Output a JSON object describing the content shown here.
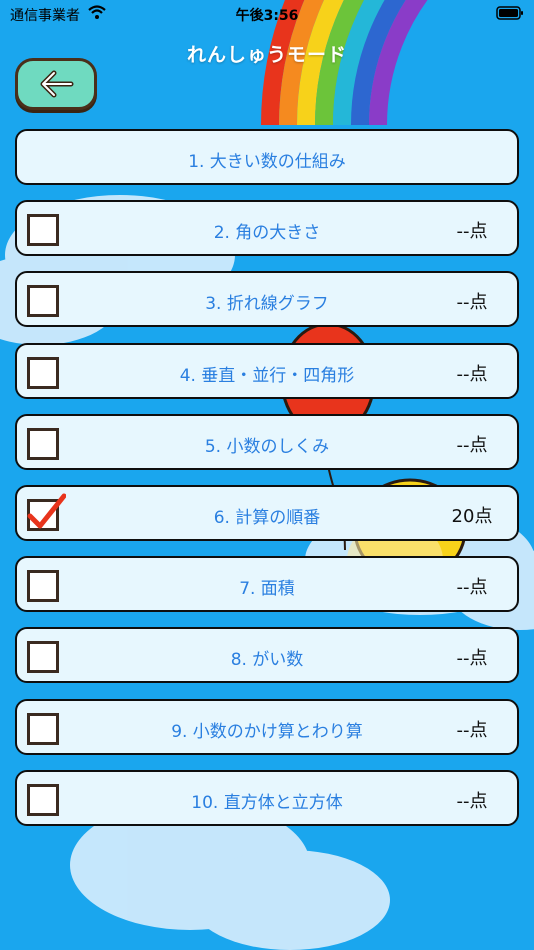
{
  "status": {
    "carrier": "通信事業者",
    "time": "午後3:56"
  },
  "header": {
    "title": "れんしゅうモード"
  },
  "rows": [
    {
      "label": "1. 大きい数の仕組み",
      "score": "",
      "checked": false,
      "has_checkbox": false
    },
    {
      "label": "2. 角の大きさ",
      "score": "--点",
      "checked": false,
      "has_checkbox": true
    },
    {
      "label": "3. 折れ線グラフ",
      "score": "--点",
      "checked": false,
      "has_checkbox": true
    },
    {
      "label": "4. 垂直・並行・四角形",
      "score": "--点",
      "checked": false,
      "has_checkbox": true
    },
    {
      "label": "5. 小数のしくみ",
      "score": "--点",
      "checked": false,
      "has_checkbox": true
    },
    {
      "label": "6. 計算の順番",
      "score": "20点",
      "checked": true,
      "has_checkbox": true
    },
    {
      "label": "7. 面積",
      "score": "--点",
      "checked": false,
      "has_checkbox": true
    },
    {
      "label": "8. がい数",
      "score": "--点",
      "checked": false,
      "has_checkbox": true
    },
    {
      "label": "9. 小数のかけ算とわり算",
      "score": "--点",
      "checked": false,
      "has_checkbox": true
    },
    {
      "label": "10. 直方体と立方体",
      "score": "--点",
      "checked": false,
      "has_checkbox": true
    }
  ],
  "colors": {
    "background": "#1aa6ee",
    "back_button": "#6fdac0",
    "label_text": "#2a7fe0",
    "checkmark": "#e8341c"
  }
}
